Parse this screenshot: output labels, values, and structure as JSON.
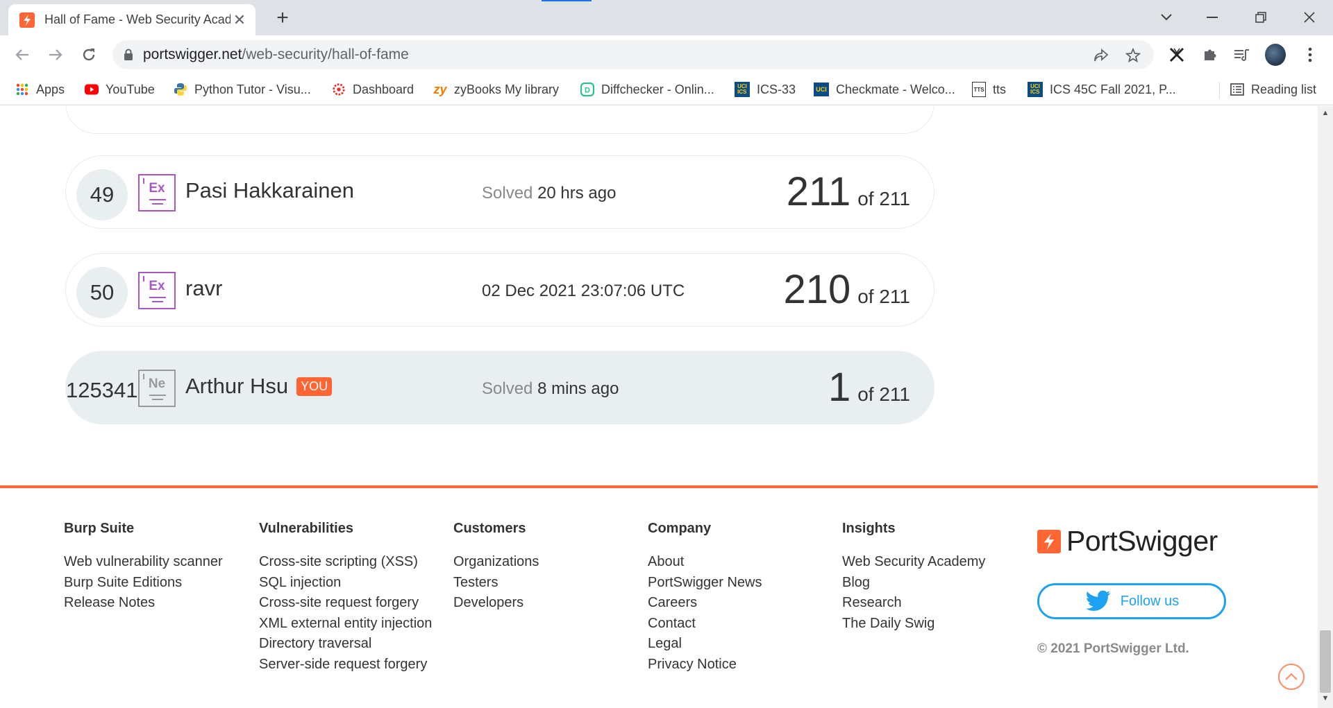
{
  "browser": {
    "tab_title": "Hall of Fame - Web Security Academy",
    "url_host": "portswigger.net",
    "url_path": "/web-security/hall-of-fame",
    "bookmarks": [
      {
        "label": "Apps",
        "icon": "apps-grid-icon"
      },
      {
        "label": "YouTube",
        "icon": "youtube-icon"
      },
      {
        "label": "Python Tutor - Visu...",
        "icon": "python-icon"
      },
      {
        "label": "Dashboard",
        "icon": "dashboard-icon"
      },
      {
        "label": "zyBooks My library",
        "icon": "zybooks-icon"
      },
      {
        "label": "Diffchecker - Onlin...",
        "icon": "diffchecker-icon"
      },
      {
        "label": "ICS-33",
        "icon": "uci-ics-icon"
      },
      {
        "label": "Checkmate - Welco...",
        "icon": "uci-icon"
      },
      {
        "label": "tts",
        "icon": "tts-icon"
      },
      {
        "label": "ICS 45C Fall 2021, P...",
        "icon": "uci-ics-icon"
      }
    ],
    "reading_list": "Reading list"
  },
  "leaderboard": [
    {
      "rank": "49",
      "badge": "Ex",
      "name": "Pasi Hakkarainen",
      "solved_label": "Solved",
      "solved_time": "20 hrs ago",
      "score": "211",
      "of": "of 211",
      "you": false
    },
    {
      "rank": "50",
      "badge": "Ex",
      "name": "ravr",
      "solved_label": "",
      "solved_time": "02 Dec 2021 23:07:06 UTC",
      "score": "210",
      "of": "of 211",
      "you": false
    },
    {
      "rank": "125341",
      "badge": "Ne",
      "name": "Arthur Hsu",
      "you_tag": "YOU",
      "solved_label": "Solved",
      "solved_time": "8 mins ago",
      "score": "1",
      "of": "of 211",
      "you": true
    }
  ],
  "footer": {
    "columns": [
      {
        "title": "Burp Suite",
        "links": [
          "Web vulnerability scanner",
          "Burp Suite Editions",
          "Release Notes"
        ]
      },
      {
        "title": "Vulnerabilities",
        "links": [
          "Cross-site scripting (XSS)",
          "SQL injection",
          "Cross-site request forgery",
          "XML external entity injection",
          "Directory traversal",
          "Server-side request forgery"
        ]
      },
      {
        "title": "Customers",
        "links": [
          "Organizations",
          "Testers",
          "Developers"
        ]
      },
      {
        "title": "Company",
        "links": [
          "About",
          "PortSwigger News",
          "Careers",
          "Contact",
          "Legal",
          "Privacy Notice"
        ]
      },
      {
        "title": "Insights",
        "links": [
          "Web Security Academy",
          "Blog",
          "Research",
          "The Daily Swig"
        ]
      }
    ],
    "logo_text": "PortSwigger",
    "follow_label": "Follow us",
    "copyright": "© 2021 PortSwigger Ltd."
  },
  "colors": {
    "accent": "#ff6633",
    "twitter": "#1da1f2",
    "badge_expert": "#a855c5"
  }
}
